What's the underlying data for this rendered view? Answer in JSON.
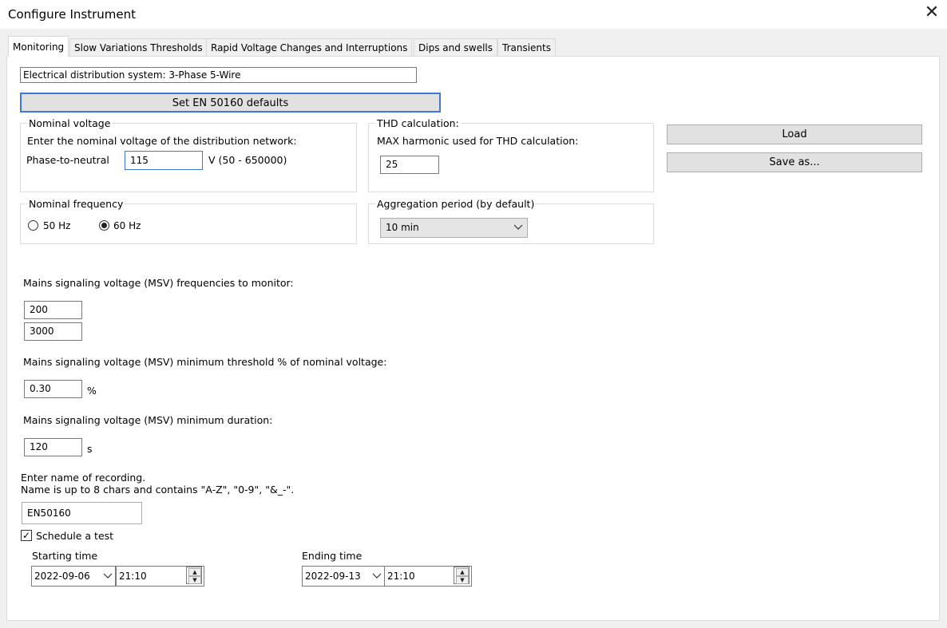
{
  "window": {
    "title": "Configure Instrument",
    "close_glyph": "✕"
  },
  "tabs": [
    {
      "label": "Monitoring"
    },
    {
      "label": "Slow Variations Thresholds"
    },
    {
      "label": "Rapid Voltage Changes and Interruptions"
    },
    {
      "label": "Dips and swells"
    },
    {
      "label": "Transients"
    }
  ],
  "active_tab": "Monitoring",
  "distribution_system": "Electrical distribution system: 3-Phase 5-Wire",
  "en_defaults_button": "Set EN 50160 defaults",
  "nominal_voltage": {
    "legend": "Nominal voltage",
    "prompt": "Enter the nominal voltage of the distribution network:",
    "row_label": "Phase-to-neutral",
    "value": "115",
    "unit_range": "V (50 - 650000)"
  },
  "thd": {
    "legend": "THD calculation:",
    "prompt": "MAX harmonic used for THD calculation:",
    "value": "25"
  },
  "load_button": "Load",
  "save_as_button": "Save as...",
  "nominal_frequency": {
    "legend": "Nominal frequency",
    "options": [
      {
        "label": "50 Hz",
        "selected": false
      },
      {
        "label": "60 Hz",
        "selected": true
      }
    ]
  },
  "aggregation": {
    "legend": "Aggregation period (by default)",
    "value": "10 min"
  },
  "msv": {
    "freq_label": "Mains signaling voltage (MSV) frequencies to monitor:",
    "frequencies": [
      "200",
      "3000"
    ],
    "threshold_label": "Mains signaling voltage (MSV) minimum threshold % of nominal voltage:",
    "threshold_value": "0.30",
    "threshold_unit": "%",
    "duration_label": "Mains signaling voltage (MSV) minimum duration:",
    "duration_value": "120",
    "duration_unit": "s"
  },
  "recording": {
    "label_line1": "Enter name of recording.",
    "label_line2": "Name is up to 8 chars and contains \"A-Z\", \"0-9\", \"&_-\".",
    "name": "EN50160"
  },
  "schedule": {
    "checked": true,
    "label": "Schedule a test",
    "start_label": "Starting time",
    "start_date": "2022-09-06",
    "start_time": "21:10",
    "end_label": "Ending time",
    "end_date": "2022-09-13",
    "end_time": "21:10"
  },
  "icons": {
    "dropdown": "chevron-down-icon",
    "spin_up": "▲",
    "spin_down": "▼",
    "checkmark": "✓"
  },
  "colors": {
    "focus_border": "#3c78d8",
    "panel_bg": "#f0f0f0"
  }
}
